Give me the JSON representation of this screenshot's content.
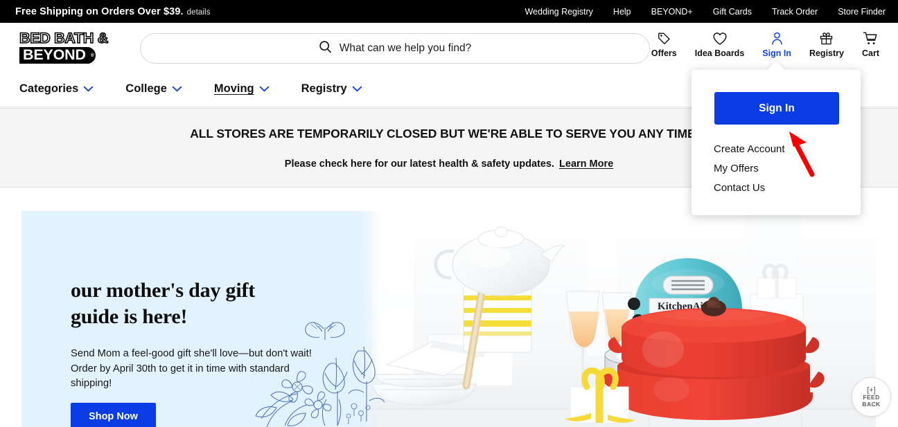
{
  "utility_bar": {
    "shipping_message": "Free Shipping on Orders Over $39.",
    "details_label": "details",
    "links": [
      {
        "label": "Wedding Registry"
      },
      {
        "label": "Help"
      },
      {
        "label": "BEYOND+"
      },
      {
        "label": "Gift Cards"
      },
      {
        "label": "Track Order"
      },
      {
        "label": "Store Finder"
      }
    ]
  },
  "header": {
    "logo_line1": "BED BATH &",
    "logo_line2": "BEYOND",
    "logo_registered": "®",
    "search": {
      "placeholder": "What can we help you find?",
      "value": "",
      "icon": "search-icon"
    },
    "actions": [
      {
        "label": "Offers",
        "icon": "tag-icon",
        "active": false
      },
      {
        "label": "Idea Boards",
        "icon": "heart-icon",
        "active": false
      },
      {
        "label": "Sign In",
        "icon": "person-icon",
        "active": true
      },
      {
        "label": "Registry",
        "icon": "gift-icon",
        "active": false
      },
      {
        "label": "Cart",
        "icon": "cart-icon",
        "active": false
      }
    ]
  },
  "main_nav": {
    "items": [
      {
        "label": "Categories",
        "icon": "chevron-down-icon",
        "hovered": false
      },
      {
        "label": "College",
        "icon": "chevron-down-icon",
        "hovered": false
      },
      {
        "label": "Moving",
        "icon": "chevron-down-icon",
        "hovered": true
      },
      {
        "label": "Registry",
        "icon": "chevron-down-icon",
        "hovered": false
      }
    ]
  },
  "banner": {
    "line1": "ALL STORES ARE TEMPORARILY CLOSED BUT WE'RE ABLE TO SERVE YOU ANY TIME O",
    "line2": "Please check here for our latest health & safety updates.",
    "link_label": "Learn More"
  },
  "signin_dropdown": {
    "button_label": "Sign In",
    "links": [
      {
        "label": "Create Account"
      },
      {
        "label": "My Offers"
      },
      {
        "label": "Contact Us"
      }
    ]
  },
  "annotation": {
    "type": "arrow",
    "color": "#f50000",
    "points_to": "sign-in-button"
  },
  "hero": {
    "heading_line1": "our mother's day gift",
    "heading_line2": "guide is here!",
    "subtext": "Send Mom a feel-good gift she'll love—but don't wait! Order by April 30th to get it in time with standard shipping!",
    "cta_label": "Shop Now",
    "background_color": "#e2f2fe",
    "image_alt": "white teapot, striped canister, champagne glasses, aqua KitchenAid stand mixer, red dutch ovens, gift boxes with yellow ribbon"
  },
  "feedback_widget": {
    "plus_label": "[+]",
    "line1": "FEED",
    "line2": "BACK"
  },
  "colors": {
    "accent_blue": "#0a3ce4",
    "link_blue": "#1042e0",
    "topbar_black": "#000000",
    "banner_gray": "#f5f5f5",
    "hero_blue": "#e2f2fe",
    "annotation_red": "#f50000"
  }
}
